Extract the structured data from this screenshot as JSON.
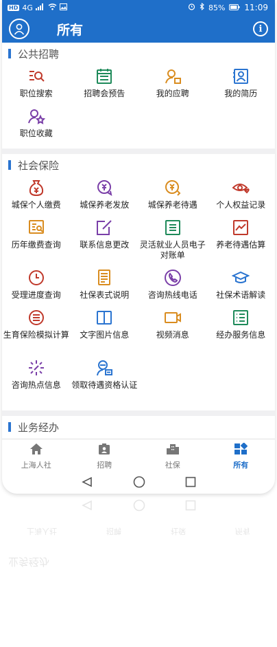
{
  "statusbar": {
    "left_badge": "HD",
    "network": "4G",
    "battery": "85%",
    "time": "11:09"
  },
  "header": {
    "title": "所有",
    "avatar_icon": "user-avatar-icon",
    "info_icon": "info-icon"
  },
  "sections": [
    {
      "title": "公共招聘",
      "items": [
        {
          "label": "职位搜索",
          "icon": "job-search-icon",
          "color": "#c0392b"
        },
        {
          "label": "招聘会预告",
          "icon": "calendar-icon",
          "color": "#1e8a5a"
        },
        {
          "label": "我的应聘",
          "icon": "application-icon",
          "color": "#d98c1f"
        },
        {
          "label": "我的简历",
          "icon": "resume-icon",
          "color": "#2a74d0"
        },
        {
          "label": "职位收藏",
          "icon": "favorite-job-icon",
          "color": "#7a3fa8"
        }
      ]
    },
    {
      "title": "社会保险",
      "items": [
        {
          "label": "城保个人缴费",
          "icon": "money-bag-icon",
          "color": "#c0392b"
        },
        {
          "label": "城保养老发放",
          "icon": "pension-payout-icon",
          "color": "#7a3fa8"
        },
        {
          "label": "城保养老待遇",
          "icon": "pension-benefit-icon",
          "color": "#d98c1f"
        },
        {
          "label": "个人权益记录",
          "icon": "eye-heart-icon",
          "color": "#c0392b"
        },
        {
          "label": "历年缴费查询",
          "icon": "payment-history-icon",
          "color": "#d98c1f"
        },
        {
          "label": "联系信息更改",
          "icon": "edit-icon",
          "color": "#7a3fa8"
        },
        {
          "label": "灵活就业人员电子对账单",
          "icon": "statement-icon",
          "color": "#1e8a5a"
        },
        {
          "label": "养老待遇估算",
          "icon": "trend-chart-icon",
          "color": "#c0392b"
        },
        {
          "label": "受理进度查询",
          "icon": "clock-icon",
          "color": "#c0392b"
        },
        {
          "label": "社保表式说明",
          "icon": "document-icon",
          "color": "#d98c1f"
        },
        {
          "label": "咨询热线电话",
          "icon": "phone-icon",
          "color": "#7a3fa8"
        },
        {
          "label": "社保术语解读",
          "icon": "graduation-cap-icon",
          "color": "#2a74d0"
        },
        {
          "label": "生育保险模拟计算",
          "icon": "calculator-icon",
          "color": "#c0392b"
        },
        {
          "label": "文字图片信息",
          "icon": "book-icon",
          "color": "#2a74d0"
        },
        {
          "label": "视频消息",
          "icon": "video-icon",
          "color": "#d98c1f"
        },
        {
          "label": "经办服务信息",
          "icon": "list-icon",
          "color": "#1e8a5a"
        },
        {
          "label": "咨询热点信息",
          "icon": "hot-spot-icon",
          "color": "#7a3fa8"
        },
        {
          "label": "领取待遇资格认证",
          "icon": "certify-icon",
          "color": "#2a74d0"
        }
      ]
    },
    {
      "title": "业务经办",
      "items": []
    }
  ],
  "tabs": [
    {
      "label": "上海人社",
      "icon": "home-icon",
      "active": false
    },
    {
      "label": "招聘",
      "icon": "recruit-icon",
      "active": false
    },
    {
      "label": "社保",
      "icon": "building-icon",
      "active": false
    },
    {
      "label": "所有",
      "icon": "grid-apps-icon",
      "active": true
    }
  ],
  "colors": {
    "primary": "#1f6fc9",
    "tab_active": "#1f6fc9",
    "tab_inactive": "#777777"
  }
}
